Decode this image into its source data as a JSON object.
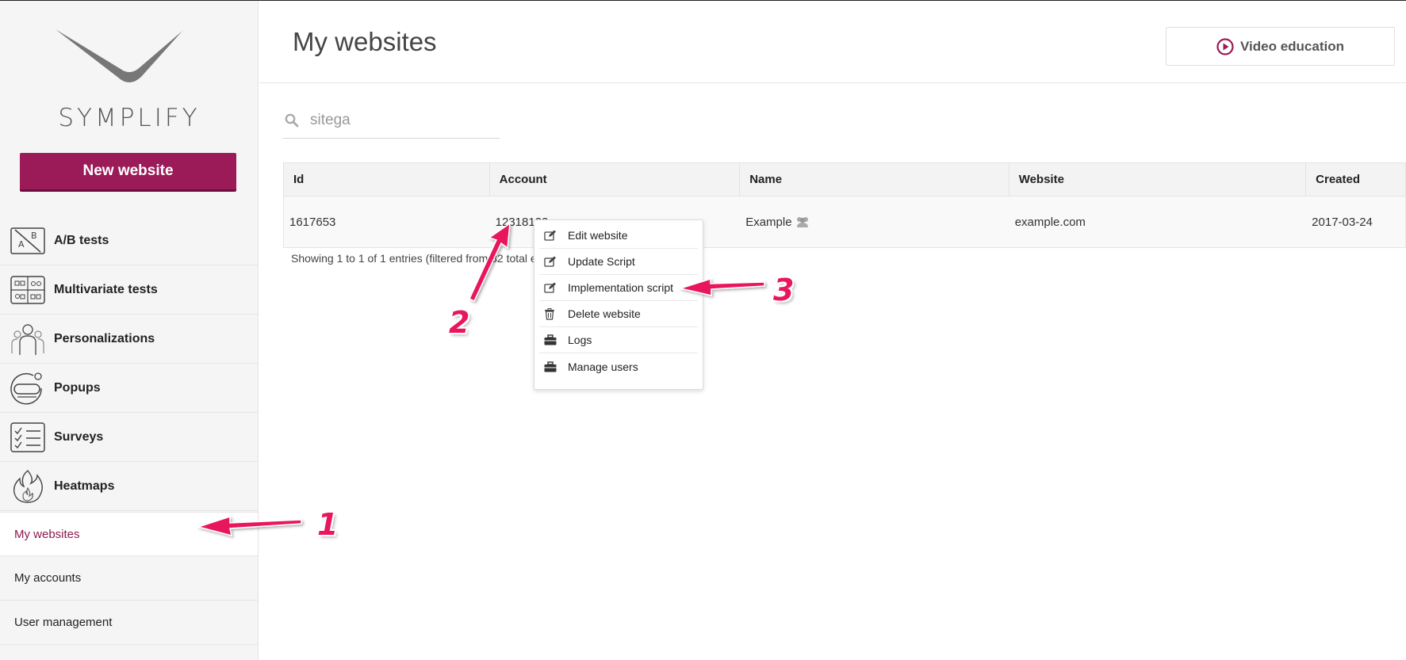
{
  "brand": {
    "name": "SYMPLIFY",
    "accent": "#9b1a58",
    "annotation_color": "#e8175d"
  },
  "sidebar": {
    "new_button": "New website",
    "items": [
      {
        "label": "A/B tests",
        "icon": "ab-test-icon"
      },
      {
        "label": "Multivariate tests",
        "icon": "multivariate-icon"
      },
      {
        "label": "Personalizations",
        "icon": "people-icon"
      },
      {
        "label": "Popups",
        "icon": "popup-icon"
      },
      {
        "label": "Surveys",
        "icon": "survey-icon"
      },
      {
        "label": "Heatmaps",
        "icon": "flame-icon"
      }
    ],
    "sub_items": [
      {
        "label": "My websites",
        "active": true
      },
      {
        "label": "My accounts",
        "active": false
      },
      {
        "label": "User management",
        "active": false
      }
    ]
  },
  "header": {
    "title": "My websites",
    "video_button": "Video education"
  },
  "search": {
    "value": "sitega"
  },
  "table": {
    "columns": [
      "Id",
      "Account",
      "Name",
      "Website",
      "Created"
    ],
    "rows": [
      {
        "id": "1617653",
        "account": "12318122",
        "name": "Example",
        "website": "example.com",
        "created": "2017-03-24"
      }
    ],
    "info": "Showing 1 to 1 of 1 entries (filtered from 32 total e"
  },
  "context_menu": {
    "items": [
      {
        "label": "Edit website",
        "icon": "edit-icon"
      },
      {
        "label": "Update Script",
        "icon": "edit-icon"
      },
      {
        "label": "Implementation script",
        "icon": "edit-icon"
      },
      {
        "label": "Delete website",
        "icon": "trash-icon"
      },
      {
        "label": "Logs",
        "icon": "briefcase-icon"
      },
      {
        "label": "Manage users",
        "icon": "briefcase-icon"
      }
    ]
  },
  "annotations": {
    "step1": "1",
    "step2": "2",
    "step3": "3"
  }
}
